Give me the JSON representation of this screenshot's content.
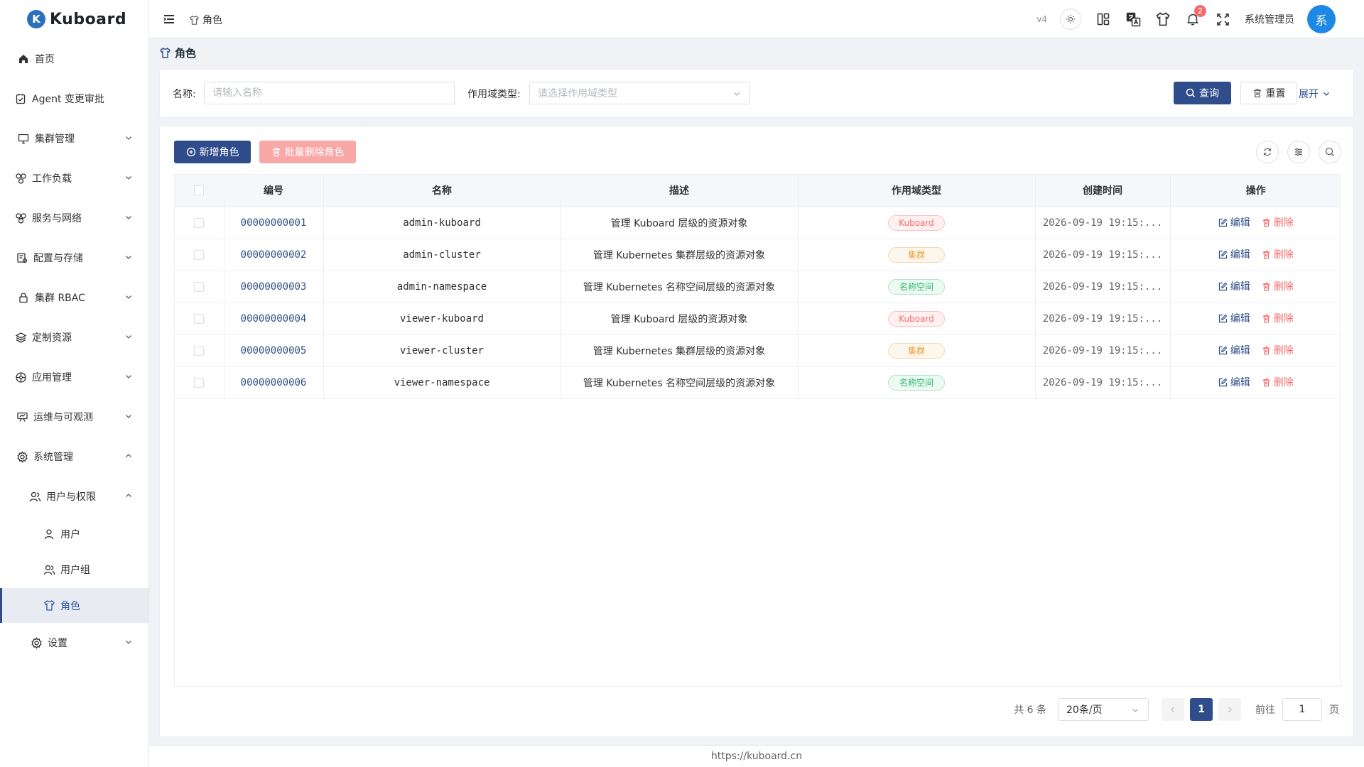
{
  "brand": {
    "logo_letter": "K",
    "name": "Kuboard"
  },
  "sidebar": {
    "items": [
      {
        "label": "首页",
        "icon": "home-icon"
      },
      {
        "label": "Agent 变更审批",
        "icon": "approval-icon"
      },
      {
        "label": "集群管理",
        "icon": "monitor-icon"
      },
      {
        "label": "工作负载",
        "icon": "workload-icon"
      },
      {
        "label": "服务与网络",
        "icon": "network-icon"
      },
      {
        "label": "配置与存储",
        "icon": "config-icon"
      },
      {
        "label": "集群 RBAC",
        "icon": "lock-icon"
      },
      {
        "label": "定制资源",
        "icon": "layers-icon"
      },
      {
        "label": "应用管理",
        "icon": "app-icon"
      },
      {
        "label": "运维与可观测",
        "icon": "ops-icon"
      },
      {
        "label": "系统管理",
        "icon": "gear-icon"
      },
      {
        "label": "用户与权限",
        "icon": "users-icon"
      },
      {
        "label": "用户",
        "icon": "user-icon"
      },
      {
        "label": "用户组",
        "icon": "user-group-icon"
      },
      {
        "label": "角色",
        "icon": "shirt-icon"
      },
      {
        "label": "设置",
        "icon": "settings-icon"
      }
    ]
  },
  "header": {
    "breadcrumb": "角色",
    "version": "v4",
    "notification_count": "2",
    "username": "系统管理员",
    "avatar_text": "系"
  },
  "page": {
    "title": "角色"
  },
  "filter": {
    "name_label": "名称:",
    "name_placeholder": "请输入名称",
    "scope_label": "作用域类型:",
    "scope_placeholder": "请选择作用域类型",
    "query_label": "查询",
    "reset_label": "重置",
    "expand_label": "展开"
  },
  "toolbar": {
    "add_label": "新增角色",
    "batch_delete_label": "批量删除角色"
  },
  "table": {
    "columns": [
      "编号",
      "名称",
      "描述",
      "作用域类型",
      "创建时间",
      "操作"
    ],
    "edit_label": "编辑",
    "delete_label": "删除",
    "rows": [
      {
        "id": "00000000001",
        "name": "admin-kuboard",
        "desc": "管理 Kuboard 层级的资源对象",
        "scope": "Kuboard",
        "time": "2026-09-19 19:15:..."
      },
      {
        "id": "00000000002",
        "name": "admin-cluster",
        "desc": "管理 Kubernetes 集群层级的资源对象",
        "scope": "集群",
        "time": "2026-09-19 19:15:..."
      },
      {
        "id": "00000000003",
        "name": "admin-namespace",
        "desc": "管理 Kubernetes 名称空间层级的资源对象",
        "scope": "名称空间",
        "time": "2026-09-19 19:15:..."
      },
      {
        "id": "00000000004",
        "name": "viewer-kuboard",
        "desc": "管理 Kuboard 层级的资源对象",
        "scope": "Kuboard",
        "time": "2026-09-19 19:15:..."
      },
      {
        "id": "00000000005",
        "name": "viewer-cluster",
        "desc": "管理 Kubernetes 集群层级的资源对象",
        "scope": "集群",
        "time": "2026-09-19 19:15:..."
      },
      {
        "id": "00000000006",
        "name": "viewer-namespace",
        "desc": "管理 Kubernetes 名称空间层级的资源对象",
        "scope": "名称空间",
        "time": "2026-09-19 19:15:..."
      }
    ]
  },
  "scope_colors": {
    "Kuboard": {
      "text": "#f56c6c",
      "bg": "#fef0f0",
      "border": "#fbc4c4"
    },
    "集群": {
      "text": "#e6a23c",
      "bg": "#fdf6ec",
      "border": "#f5dab1"
    },
    "名称空间": {
      "text": "#2bb673",
      "bg": "#ecfaf2",
      "border": "#b3e6c9"
    }
  },
  "pagination": {
    "total_label": "共 6 条",
    "page_size": "20条/页",
    "current_page": "1",
    "goto_label": "前往",
    "goto_value": "1",
    "page_suffix": "页"
  },
  "footer": {
    "url": "https://kuboard.cn"
  }
}
